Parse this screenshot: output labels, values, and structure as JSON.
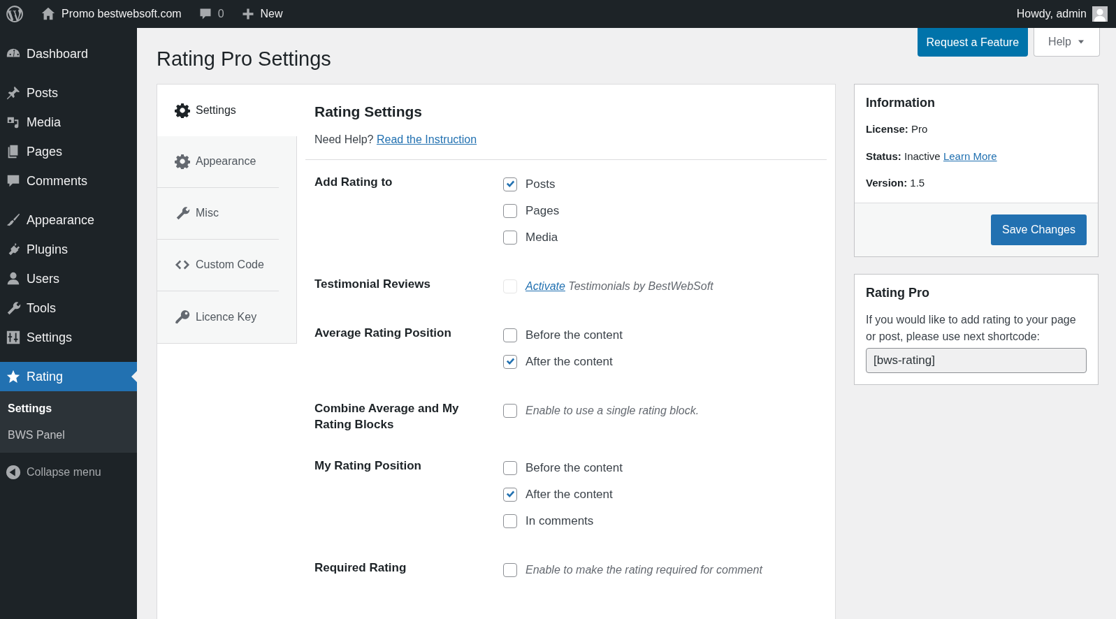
{
  "admin_bar": {
    "site": "Promo bestwebsoft.com",
    "comments": "0",
    "new": "New",
    "greeting": "Howdy, admin"
  },
  "sidebar": {
    "groups": [
      [
        {
          "label": "Dashboard",
          "selected": false
        }
      ],
      [
        {
          "label": "Posts",
          "selected": false
        },
        {
          "label": "Media",
          "selected": false
        },
        {
          "label": "Pages",
          "selected": false
        },
        {
          "label": "Comments",
          "selected": false
        }
      ],
      [
        {
          "label": "Appearance",
          "selected": false
        },
        {
          "label": "Plugins",
          "selected": false
        },
        {
          "label": "Users",
          "selected": false
        },
        {
          "label": "Tools",
          "selected": false
        },
        {
          "label": "Settings",
          "selected": false
        }
      ],
      [
        {
          "label": "Rating",
          "selected": true
        }
      ]
    ],
    "submenu": [
      {
        "label": "Settings",
        "selected": true
      },
      {
        "label": "BWS Panel",
        "selected": false
      }
    ],
    "collapse": "Collapse menu"
  },
  "header_buttons": {
    "request": "Request a Feature",
    "help": "Help"
  },
  "page_title": "Rating Pro Settings",
  "tabs": [
    {
      "label": "Settings",
      "selected": true
    },
    {
      "label": "Appearance",
      "selected": false
    },
    {
      "label": "Misc",
      "selected": false
    },
    {
      "label": "Custom Code",
      "selected": false
    },
    {
      "label": "Licence Key",
      "selected": false
    }
  ],
  "section": {
    "title": "Rating Settings",
    "help": "Need Help?",
    "help_link": "Read the Instruction"
  },
  "settings": [
    {
      "label": "Add Rating to",
      "options": [
        {
          "kind": "option",
          "label": "Posts",
          "checked": true
        },
        {
          "kind": "option",
          "label": "Pages",
          "checked": false
        },
        {
          "kind": "option",
          "label": "Media",
          "checked": false
        }
      ]
    },
    {
      "label": "Testimonial Reviews",
      "options": [
        {
          "kind": "activate",
          "link": "Activate",
          "label": "Testimonials by BestWebSoft",
          "checked": false,
          "disabled": true
        }
      ]
    },
    {
      "label": "Average Rating Position",
      "options": [
        {
          "kind": "option",
          "label": "Before the content",
          "checked": false
        },
        {
          "kind": "option",
          "label": "After the content",
          "checked": true
        }
      ]
    },
    {
      "label": "Combine Average and My Rating Blocks",
      "options": [
        {
          "kind": "note",
          "label": "Enable to use a single rating block.",
          "checked": false
        }
      ]
    },
    {
      "label": "My Rating Position",
      "options": [
        {
          "kind": "option",
          "label": "Before the content",
          "checked": false
        },
        {
          "kind": "option",
          "label": "After the content",
          "checked": true
        },
        {
          "kind": "option",
          "label": "In comments",
          "checked": false
        }
      ]
    },
    {
      "label": "Required Rating",
      "options": [
        {
          "kind": "note",
          "label": "Enable to make the rating required for comment",
          "checked": false
        }
      ]
    }
  ],
  "info_box": {
    "title": "Information",
    "fields": [
      {
        "label": "License:",
        "value": "Pro"
      },
      {
        "label": "Status:",
        "value": "Inactive",
        "link": "Learn More"
      },
      {
        "label": "Version:",
        "value": "1.5"
      }
    ],
    "save": "Save Changes"
  },
  "shortcode_box": {
    "title": "Rating Pro",
    "text": "If you would like to add rating to your page or post, please use next shortcode:",
    "value": "[bws-rating]"
  }
}
